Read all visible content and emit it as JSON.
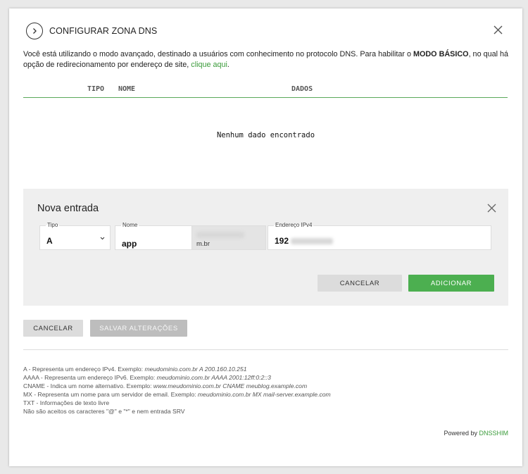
{
  "modal": {
    "title": "CONFIGURAR ZONA DNS",
    "info_text_1": "Você está utilizando o modo avançado, destinado a usuários com conhecimento no protocolo DNS. Para habilitar o ",
    "info_bold": "MODO BÁSICO",
    "info_text_2": ", no qual há opção de redirecionamento por endereço de site, ",
    "info_link": "clique aqui",
    "info_end": "."
  },
  "table": {
    "headers": {
      "type": "TIPO",
      "name": "NOME",
      "data": "DADOS"
    },
    "empty_message": "Nenhum dado encontrado"
  },
  "new_entry": {
    "title": "Nova entrada",
    "type_label": "Tipo",
    "type_value": "A",
    "name_label": "Nome",
    "name_value": "app",
    "domain_suffix_end": "m.br",
    "ip_label": "Endereço IPv4",
    "ip_value": "192",
    "cancel_label": "CANCELAR",
    "add_label": "ADICIONAR"
  },
  "actions": {
    "cancel_label": "CANCELAR",
    "save_label": "SALVAR ALTERAÇÕES"
  },
  "legend": [
    {
      "key": "A",
      "desc": " - Representa um endereço IPv4. Exemplo: ",
      "example": "meudominio.com.br A 200.160.10.251"
    },
    {
      "key": "AAAA",
      "desc": " - Representa um endereço IPv6. Exemplo: ",
      "example": "meudominio.com.br AAAA 2001:12ff:0:2::3"
    },
    {
      "key": "CNAME",
      "desc": " - Indica um nome alternativo. Exemplo: ",
      "example": "www.meudominio.com.br CNAME meublog.example.com"
    },
    {
      "key": "MX",
      "desc": " - Representa um nome para um servidor de email. Exemplo: ",
      "example": "meudominio.com.br MX mail-server.example.com"
    },
    {
      "key": "TXT",
      "desc": " - Informações de texto livre",
      "example": ""
    }
  ],
  "legend_note": "Não são aceitos os caracteres \"@\" e \"*\" e nem entrada SRV",
  "footer": {
    "powered_by": "Powered by ",
    "brand": "DNSSHIM"
  }
}
